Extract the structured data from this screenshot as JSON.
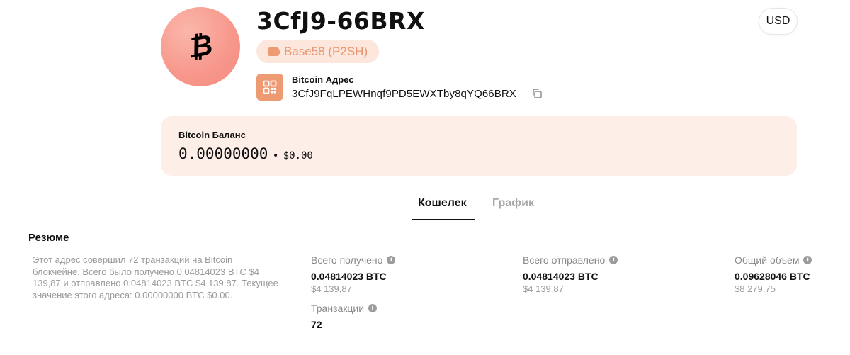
{
  "header": {
    "coin_symbol": "₿",
    "address_short": "3CfJ9-66BRX",
    "format_label": "Base58 (P2SH)",
    "address_label": "Bitcoin Адрес",
    "address_full": "3CfJ9FqLPEWHnqf9PD5EWXTby8qYQ66BRX",
    "currency_button": "USD"
  },
  "balance": {
    "label": "Bitcoin Баланс",
    "btc": "0.00000000",
    "separator": "•",
    "usd": "$0.00"
  },
  "tabs": [
    {
      "label": "Кошелек",
      "active": true
    },
    {
      "label": "График",
      "active": false
    }
  ],
  "summary": {
    "title": "Резюме",
    "text": "Этот адрес совершил 72 транзакций на Bitcoin блокчейне. Всего было получено 0.04814023 BTC $4 139,87 и отправлено 0.04814023 BTC $4 139,87. Текущее значение этого адреса: 0.00000000 BTC $0.00.",
    "stats": {
      "received": {
        "label": "Всего получено",
        "value": "0.04814023 BTC",
        "sub": "$4 139,87"
      },
      "sent": {
        "label": "Всего отправлено",
        "value": "0.04814023 BTC",
        "sub": "$4 139,87"
      },
      "volume": {
        "label": "Общий объем",
        "value": "0.09628046 BTC",
        "sub": "$8 279,75"
      },
      "transactions": {
        "label": "Транзакции",
        "value": "72"
      }
    }
  },
  "colors": {
    "accent": "#ee9a73",
    "balance_bg": "#fdeee7",
    "pill_bg": "#fde6dc",
    "avatar": "#f7968a"
  },
  "icons": {
    "avatar": "bitcoin-icon",
    "format": "wallet-icon",
    "qr": "qr-code-icon",
    "copy": "copy-icon",
    "info": "info-icon"
  }
}
